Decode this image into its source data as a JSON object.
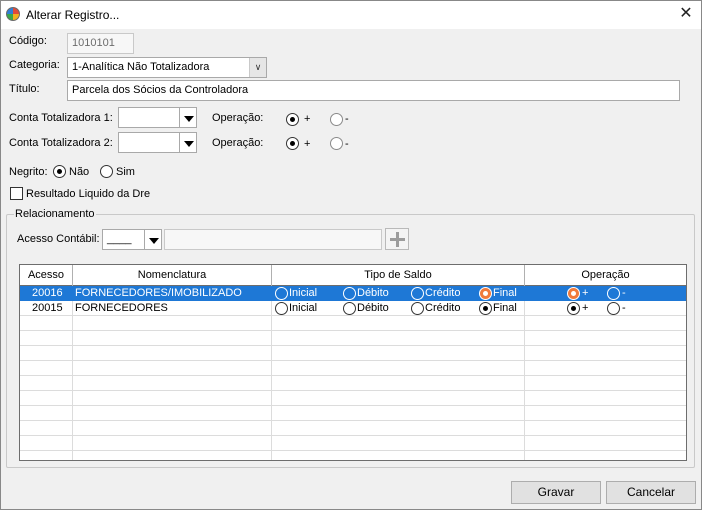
{
  "window": {
    "title": "Alterar Registro..."
  },
  "form": {
    "codigo_label": "Código:",
    "codigo_value": "1010101",
    "categoria_label": "Categoria:",
    "categoria_value": "1-Analítica Não Totalizadora",
    "titulo_label": "Título:",
    "titulo_value": "Parcela dos Sócios da Controladora",
    "conta1_label": "Conta Totalizadora 1:",
    "conta2_label": "Conta Totalizadora 2:",
    "operacao_label": "Operação:",
    "plus_label": "+",
    "minus_label": "-",
    "negrito_label": "Negrito:",
    "nao_label": "Não",
    "sim_label": "Sim",
    "resultado_label": "Resultado Liquido da Dre"
  },
  "relacionamento": {
    "group_title": "Relacionamento",
    "acesso_label": "Acesso Contábil:",
    "acesso_value": "____",
    "columns": [
      "Acesso",
      "Nomenclatura",
      "Tipo de Saldo",
      "Operação"
    ],
    "saldo_options": [
      "Inicial",
      "Débito",
      "Crédito",
      "Final"
    ],
    "rows": [
      {
        "acesso": "20016",
        "nomenclatura": "FORNECEDORES/IMOBILIZADO",
        "saldo": "Final",
        "operacao": "+",
        "selected": true
      },
      {
        "acesso": "20015",
        "nomenclatura": "FORNECEDORES",
        "saldo": "Final",
        "operacao": "+",
        "selected": false
      }
    ]
  },
  "buttons": {
    "gravar": "Gravar",
    "cancelar": "Cancelar"
  }
}
